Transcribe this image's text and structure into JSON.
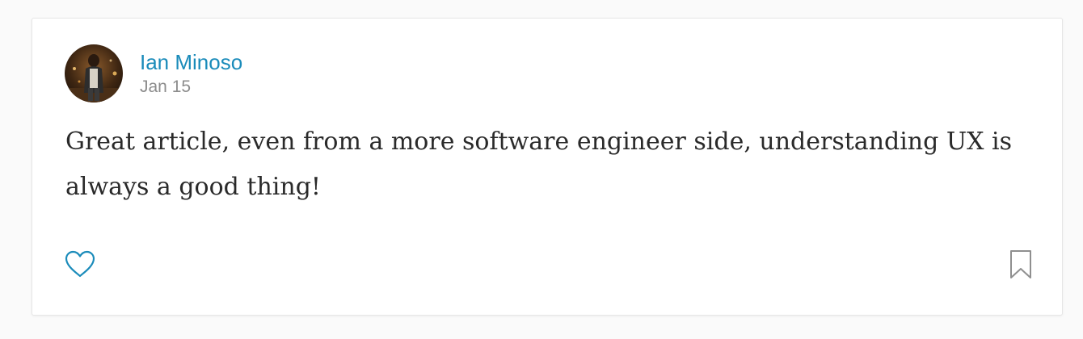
{
  "comment": {
    "author": "Ian Minoso",
    "date": "Jan 15",
    "text": "Great article, even from a more software engineer side, understanding UX is always a good thing!"
  },
  "actions": {
    "like_icon": "heart-outline",
    "bookmark_icon": "bookmark-outline"
  },
  "colors": {
    "accent": "#1a8bba",
    "meta_text": "#8c8c8c",
    "body_text": "#2a2a2a",
    "background": "#fafafa",
    "card": "#ffffff"
  }
}
